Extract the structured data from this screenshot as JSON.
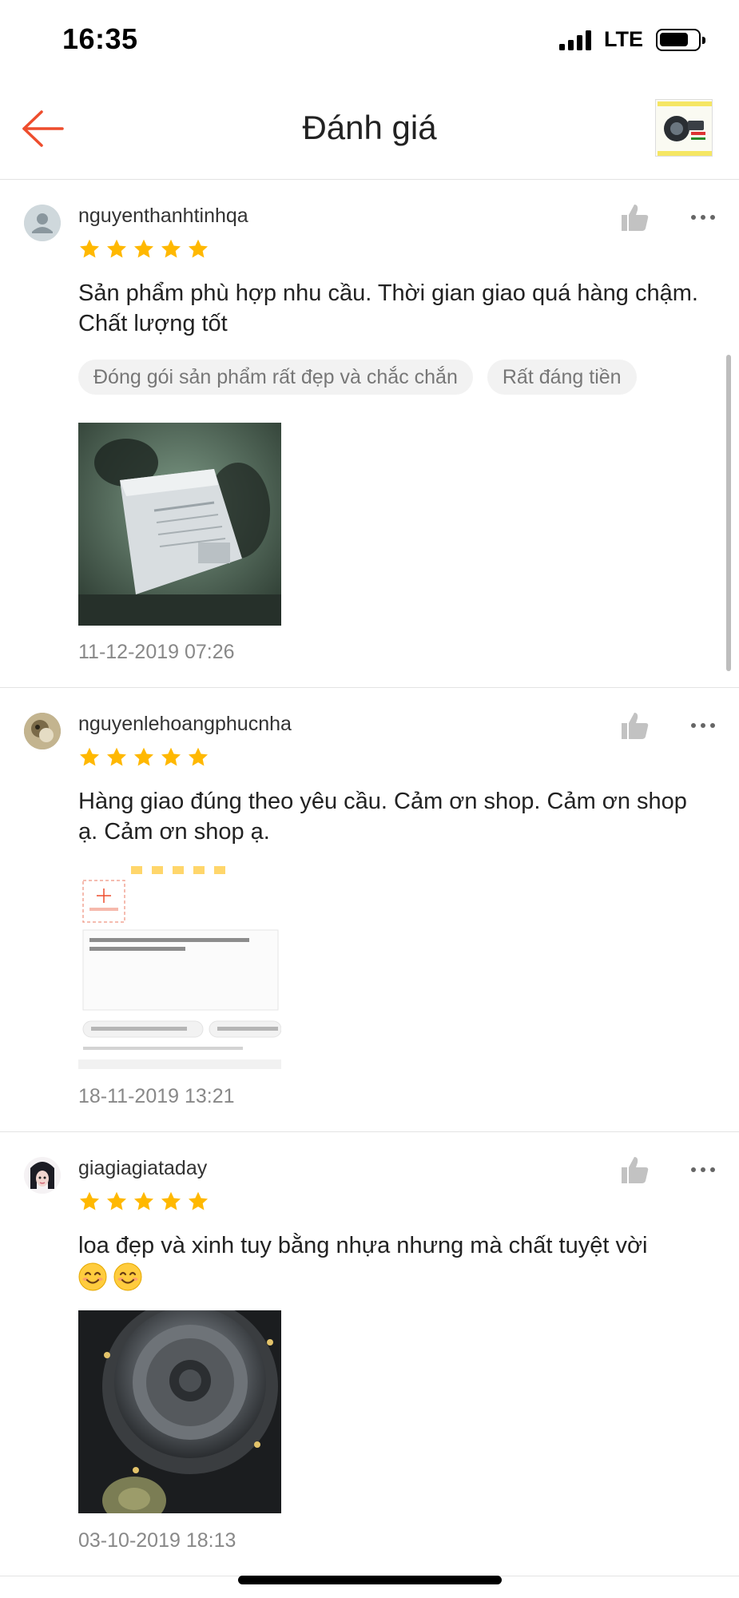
{
  "status_bar": {
    "time": "16:35",
    "network": "LTE",
    "battery_level": 0.75,
    "signal_icon": "signal-bars-icon",
    "battery_icon": "battery-icon"
  },
  "header": {
    "title": "Đánh giá",
    "back_icon": "arrow-left-icon",
    "back_icon_color": "#ee4d2d",
    "thumbnail": "shop-product-thumbnail"
  },
  "colors": {
    "accent": "#ee4d2d",
    "star": "#ffb800",
    "tag_bg": "#f2f2f2",
    "muted_text": "#888888"
  },
  "reviews": [
    {
      "username": "nguyenthanhtinhqa",
      "avatar": "default-user-avatar",
      "rating": 5,
      "text": "Sản phẩm phù hợp nhu cầu. Thời gian giao quá hàng chậm. Chất lượng tốt",
      "tags": [
        "Đóng gói sản phẩm rất đẹp và chắc chắn",
        "Rất đáng tiền"
      ],
      "photo": "package-box-photo",
      "date": "11-12-2019 07:26"
    },
    {
      "username": "nguyenlehoangphucnha",
      "avatar": "user-photo-avatar",
      "rating": 5,
      "text": "Hàng giao đúng theo yêu cầu. Cảm ơn shop. Cảm ơn shop ạ. Cảm ơn shop ạ.",
      "tags": [],
      "photo": "review-screenshot-photo",
      "date": "18-11-2019 13:21"
    },
    {
      "username": "giagiagiataday",
      "avatar": "user-photo-avatar",
      "rating": 5,
      "text": "loa đẹp và xinh tuy bằng nhựa nhưng mà chất tuyệt vời",
      "emojis": [
        "smiling-face-emoji",
        "smiling-face-emoji"
      ],
      "tags": [],
      "photo": "speaker-photo",
      "date": "03-10-2019 18:13"
    }
  ]
}
